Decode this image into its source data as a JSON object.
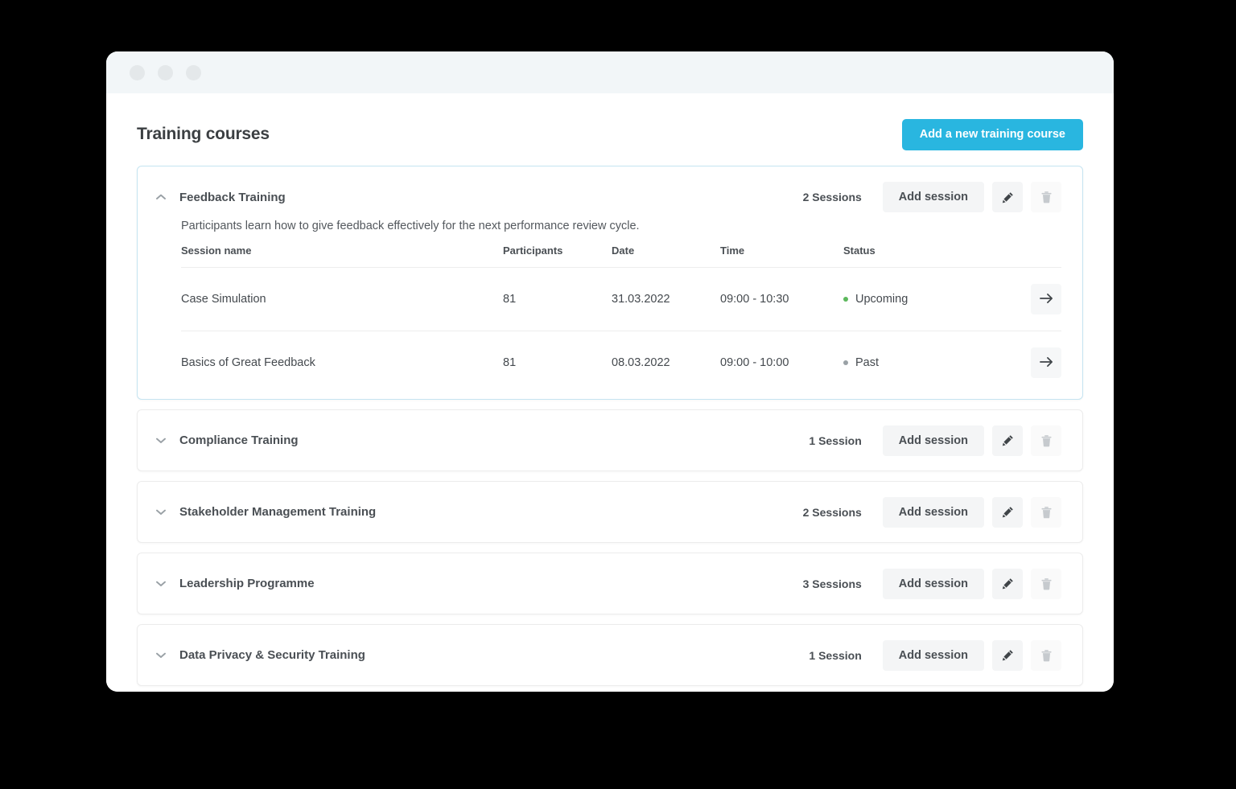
{
  "window": {
    "traffic_lights": [
      "close-dot",
      "minimize-dot",
      "maximize-dot"
    ]
  },
  "header": {
    "title": "Training courses",
    "add_course_label": "Add a new training course",
    "accent_color": "#29b6e0"
  },
  "table_headers": {
    "session_name": "Session name",
    "participants": "Participants",
    "date": "Date",
    "time": "Time",
    "status": "Status"
  },
  "actions": {
    "add_session_label": "Add session",
    "edit_icon": "pencil-icon",
    "delete_icon": "trash-icon",
    "open_icon": "arrow-right-icon",
    "expand_icon": "chevron-down-icon",
    "collapse_icon": "chevron-up-icon"
  },
  "status_colors": {
    "upcoming": "#5cb85c",
    "past": "#9aa1a6"
  },
  "courses": [
    {
      "name": "Feedback Training",
      "session_count_label": "2 Sessions",
      "expanded": true,
      "description": "Participants learn how to give feedback effectively for the next performance review cycle.",
      "sessions": [
        {
          "name": "Case Simulation",
          "participants": "81",
          "date": "31.03.2022",
          "time": "09:00 - 10:30",
          "status": "Upcoming",
          "status_kind": "upcoming"
        },
        {
          "name": "Basics of Great Feedback",
          "participants": "81",
          "date": "08.03.2022",
          "time": "09:00 - 10:00",
          "status": "Past",
          "status_kind": "past"
        }
      ]
    },
    {
      "name": "Compliance Training",
      "session_count_label": "1 Session",
      "expanded": false
    },
    {
      "name": "Stakeholder Management Training",
      "session_count_label": "2 Sessions",
      "expanded": false
    },
    {
      "name": "Leadership Programme",
      "session_count_label": "3 Sessions",
      "expanded": false
    },
    {
      "name": "Data Privacy & Security Training",
      "session_count_label": "1 Session",
      "expanded": false
    }
  ]
}
